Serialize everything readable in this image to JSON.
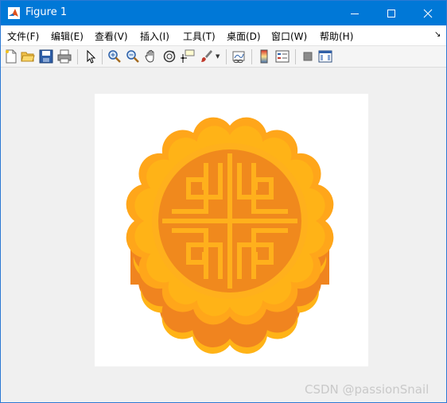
{
  "window": {
    "title": "Figure 1",
    "accent_color": "#0078d7"
  },
  "menu": {
    "items": [
      "文件(F)",
      "编辑(E)",
      "查看(V)",
      "插入(I)",
      "工具(T)",
      "桌面(D)",
      "窗口(W)",
      "帮助(H)"
    ],
    "overflow_icon": "arrow-icon"
  },
  "toolbar": {
    "icons": [
      "new-figure-icon",
      "open-file-icon",
      "save-icon",
      "print-icon",
      "pointer-icon",
      "zoom-in-icon",
      "zoom-out-icon",
      "pan-hand-icon",
      "rotate-3d-icon",
      "data-cursor-icon",
      "brush-icon",
      "link-plot-icon",
      "colorbar-icon",
      "legend-icon",
      "hide-plot-tools-icon",
      "show-plot-tools-icon"
    ]
  },
  "figure": {
    "image_subject": "mooncake-icon",
    "colors": {
      "base": "#ffb317",
      "side": "#f0841f",
      "top": "#ffa61a",
      "inner": "#f0891d",
      "pattern": "#ffb01c"
    }
  },
  "watermark": {
    "text": "CSDN @passionSnail"
  }
}
